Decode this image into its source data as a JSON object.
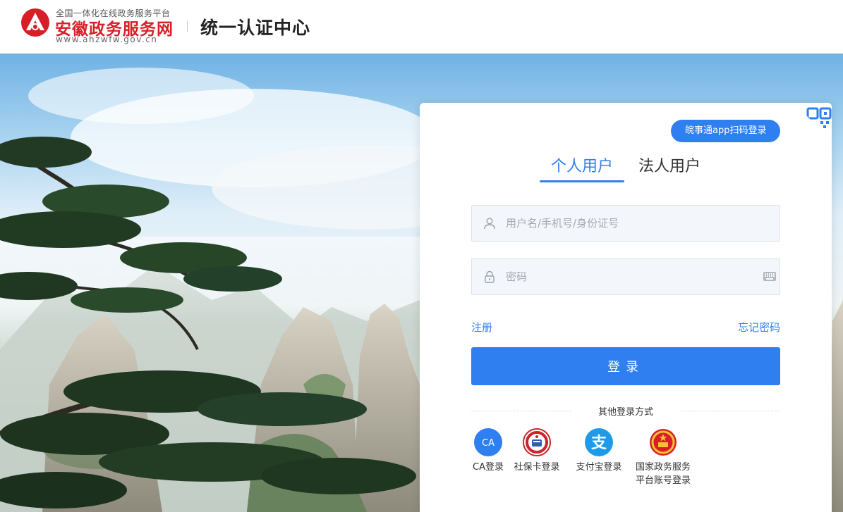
{
  "header": {
    "brand_top": "全国一体化在线政务服务平台",
    "brand_name": "安徽政务服务网",
    "brand_url": "www.ahzwfw.gov.cn",
    "title": "统一认证中心"
  },
  "login": {
    "scan_badge": "皖事通app扫码登录",
    "tabs": [
      {
        "label": "个人用户",
        "active": true
      },
      {
        "label": "法人用户",
        "active": false
      }
    ],
    "username_placeholder": "用户名/手机号/身份证号",
    "username_value": "",
    "password_placeholder": "密码",
    "password_value": "",
    "register_label": "注册",
    "forgot_label": "忘记密码",
    "login_label": "登录",
    "other_title": "其他登录方式",
    "methods": [
      {
        "label": "CA登录",
        "icon": "ca-icon",
        "icon_text": "CA"
      },
      {
        "label": "社保卡登录",
        "icon": "social-security-card-icon"
      },
      {
        "label": "支付宝登录",
        "icon": "alipay-icon",
        "icon_text": "支"
      },
      {
        "label_line1": "国家政务服务",
        "label_line2": "平台账号登录",
        "icon": "national-emblem-icon"
      }
    ]
  },
  "colors": {
    "accent": "#2f7ff0",
    "brand_red": "#d81e26"
  }
}
